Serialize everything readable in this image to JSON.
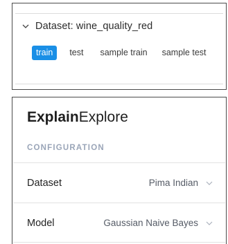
{
  "dataset_panel": {
    "header": {
      "title": "Dataset: wine_quality_red",
      "icon": "chevron-down-icon"
    },
    "tabs": [
      {
        "label": "train",
        "active": true
      },
      {
        "label": "test",
        "active": false
      },
      {
        "label": "sample train",
        "active": false
      },
      {
        "label": "sample test",
        "active": false
      }
    ]
  },
  "app": {
    "brand_bold": "Explain",
    "brand_regular": "Explore",
    "section_label": "CONFIGURATION",
    "config": {
      "dataset": {
        "label": "Dataset",
        "value": "Pima Indian",
        "icon": "chevron-down-icon"
      },
      "model": {
        "label": "Model",
        "value": "Gaussian Naive Bayes",
        "icon": "chevron-down-icon"
      }
    }
  },
  "colors": {
    "accent": "#1a8fe6",
    "section_label": "#9aa5b8",
    "panel_border": "#4a4a4a"
  }
}
